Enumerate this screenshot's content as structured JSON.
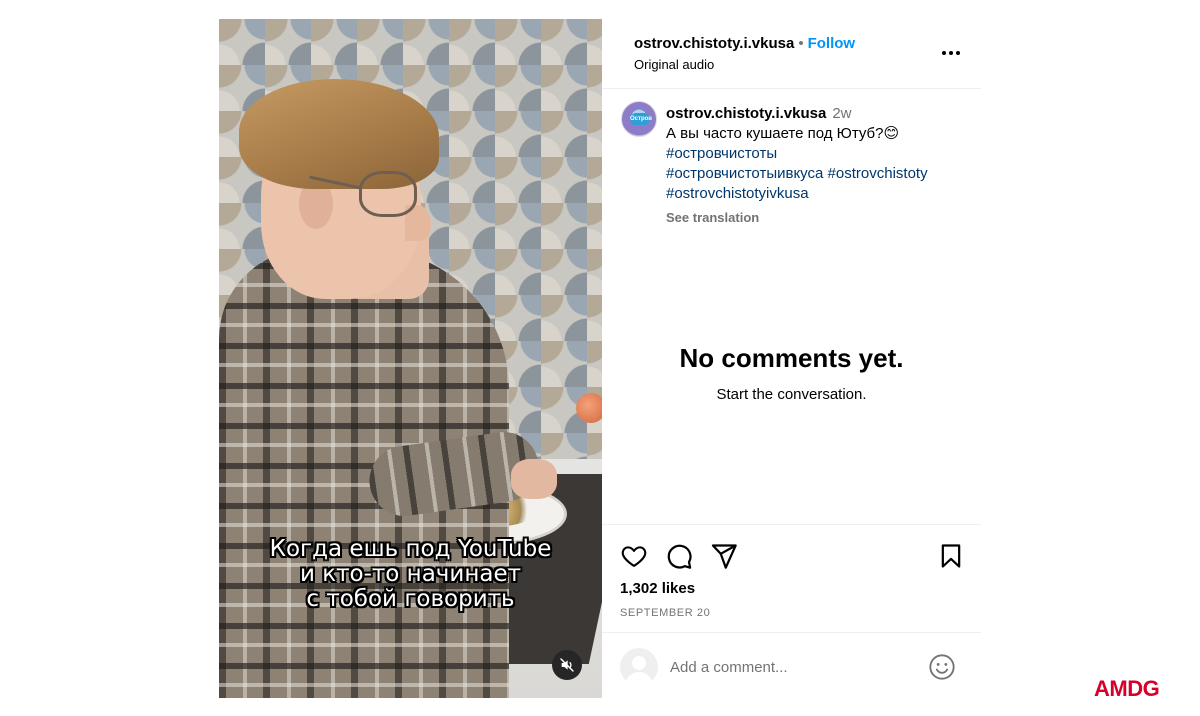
{
  "video": {
    "caption_lines": [
      "Когда ешь под YouTube",
      "и кто-то начинает",
      "с тобой говорить"
    ],
    "mute_icon": "speaker-muted-icon"
  },
  "header": {
    "username": "ostrov.chistoty.i.vkusa",
    "separator": "•",
    "follow_label": "Follow",
    "audio_label": "Original audio",
    "more_icon": "more-horizontal-icon"
  },
  "post": {
    "avatar_text": "Остров",
    "username": "ostrov.chistoty.i.vkusa",
    "time_ago": "2w",
    "text": "А вы часто кушаете под Ютуб?😊",
    "hashtags": [
      "#островчистоты",
      "#островчистотыивкуса",
      "#ostrovchistoty",
      "#ostrovchistotyivkusa"
    ],
    "see_translation": "See translation"
  },
  "comments": {
    "empty_title": "No comments yet.",
    "empty_subtitle": "Start the conversation."
  },
  "actions": {
    "icons": [
      "heart-icon",
      "comment-icon",
      "share-icon",
      "bookmark-icon"
    ],
    "likes": "1,302 likes",
    "date": "SEPTEMBER 20"
  },
  "comment_input": {
    "placeholder": "Add a comment...",
    "emoji_icon": "emoji-icon"
  },
  "brand": {
    "label": "AMDG",
    "color": "#d6002a"
  },
  "colors": {
    "link": "#0095f6",
    "hashtag": "#00376b",
    "muted": "#737373",
    "divider": "#efefef"
  }
}
